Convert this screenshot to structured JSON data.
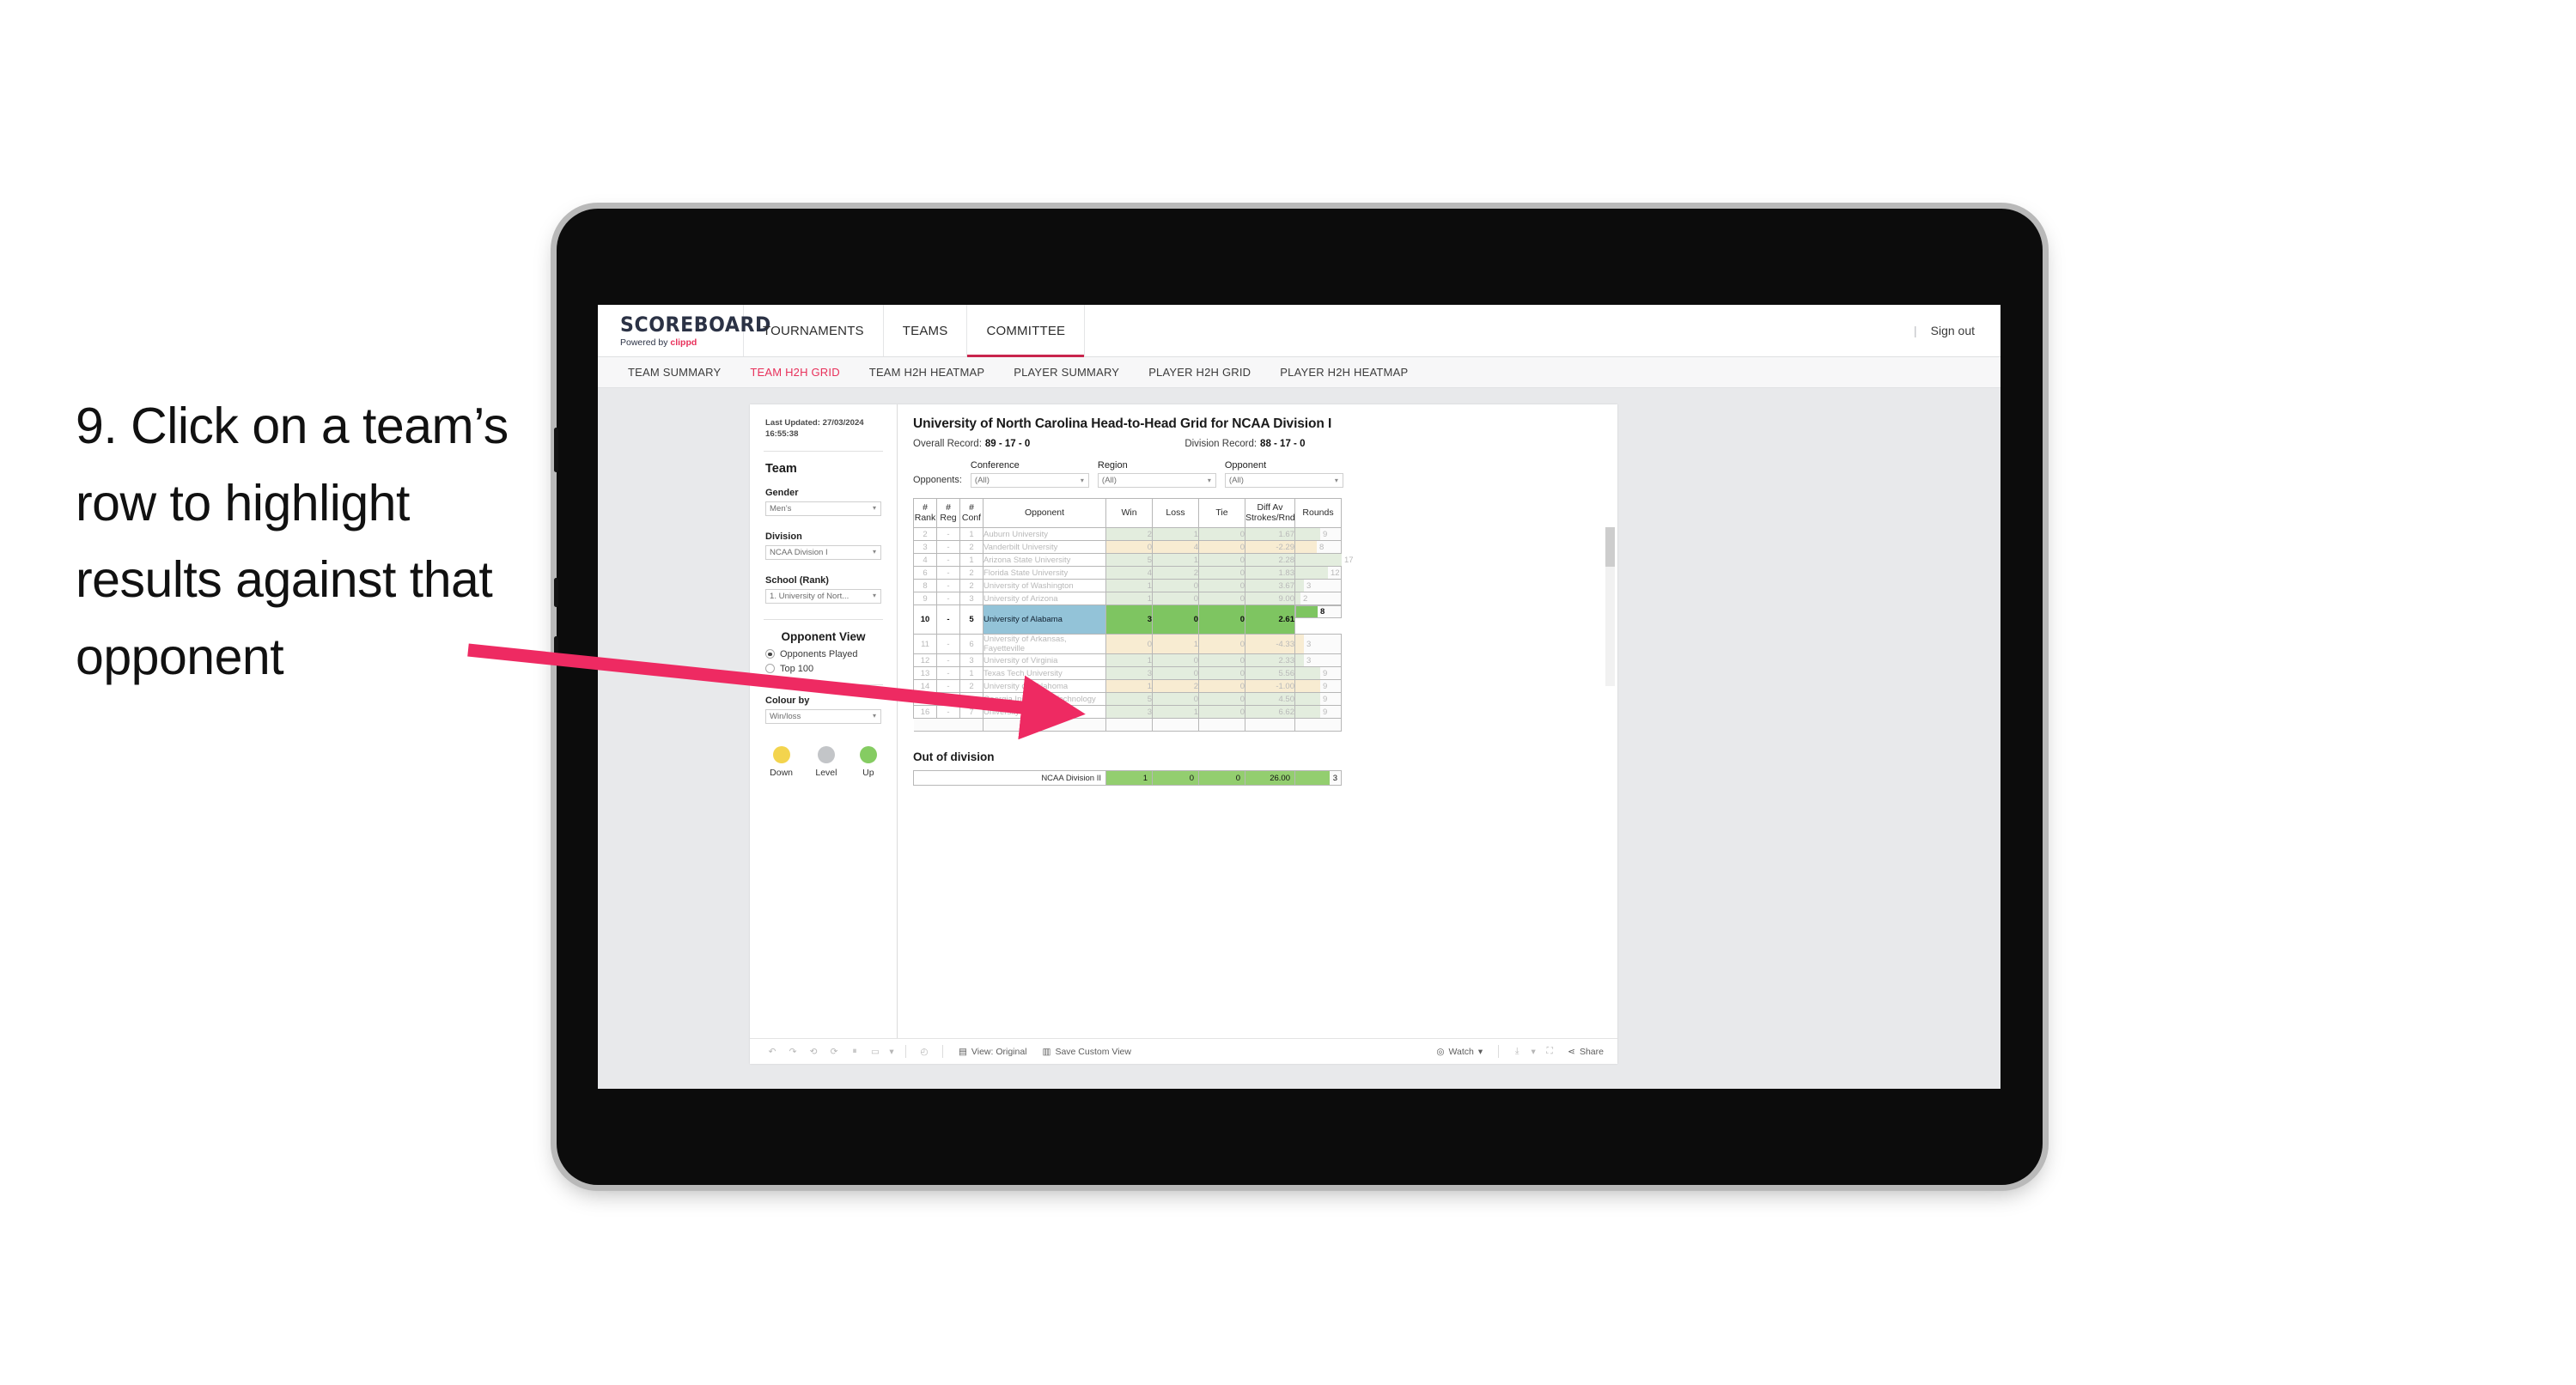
{
  "annotation": {
    "text": "9. Click on a team’s row to highlight results against that opponent",
    "arrow_color": "#ee2a62"
  },
  "app": {
    "brand": {
      "name": "SCOREBOARD",
      "powered_prefix": "Powered by ",
      "powered_brand": "clippd"
    },
    "top_nav": [
      {
        "label": "TOURNAMENTS",
        "active": false
      },
      {
        "label": "TEAMS",
        "active": false
      },
      {
        "label": "COMMITTEE",
        "active": true
      }
    ],
    "sign_out": "Sign out",
    "sub_nav": [
      {
        "label": "TEAM SUMMARY",
        "active": false
      },
      {
        "label": "TEAM H2H GRID",
        "active": true
      },
      {
        "label": "TEAM H2H HEATMAP",
        "active": false
      },
      {
        "label": "PLAYER SUMMARY",
        "active": false
      },
      {
        "label": "PLAYER H2H GRID",
        "active": false
      },
      {
        "label": "PLAYER H2H HEATMAP",
        "active": false
      }
    ]
  },
  "sidepanel": {
    "last_updated": "Last Updated: 27/03/2024 16:55:38",
    "team_heading": "Team",
    "gender_label": "Gender",
    "gender_value": "Men’s",
    "division_label": "Division",
    "division_value": "NCAA Division I",
    "school_label": "School (Rank)",
    "school_value": "1. University of Nort...",
    "opponent_view_heading": "Opponent View",
    "opponent_view_options": [
      {
        "label": "Opponents Played",
        "selected": true
      },
      {
        "label": "Top 100",
        "selected": false
      }
    ],
    "colour_by_label": "Colour by",
    "colour_by_value": "Win/loss",
    "legend": [
      {
        "label": "Down",
        "color": "#f3d44e"
      },
      {
        "label": "Level",
        "color": "#c3c5c8"
      },
      {
        "label": "Up",
        "color": "#85cc62"
      }
    ]
  },
  "main": {
    "title": "University of North Carolina Head-to-Head Grid for NCAA Division I",
    "overall_record_label": "Overall Record:",
    "overall_record_value": "89 - 17 - 0",
    "division_record_label": "Division Record:",
    "division_record_value": "88 - 17 - 0",
    "opponents_label": "Opponents:",
    "filters": [
      {
        "label": "Conference",
        "value": "(All)"
      },
      {
        "label": "Region",
        "value": "(All)"
      },
      {
        "label": "Opponent",
        "value": "(All)"
      }
    ],
    "out_of_division_title": "Out of division"
  },
  "chart_data": {
    "type": "table",
    "title": "University of North Carolina Head-to-Head Grid for NCAA Division I",
    "columns": [
      "# Rank",
      "# Reg",
      "# Conf",
      "Opponent",
      "Win",
      "Loss",
      "Tie",
      "Diff Av Strokes/Rnd",
      "Rounds"
    ],
    "column_headers_multiline": [
      [
        "#",
        "Rank"
      ],
      [
        "#",
        "Reg"
      ],
      [
        "#",
        "Conf"
      ],
      [
        "Opponent"
      ],
      [
        "Win"
      ],
      [
        "Loss"
      ],
      [
        "Tie"
      ],
      [
        "Diff Av",
        "Strokes/Rnd"
      ],
      [
        "Rounds"
      ]
    ],
    "rows": [
      {
        "rank": "2",
        "reg": "-",
        "conf": "1",
        "opponent": "Auburn University",
        "win": "2",
        "loss": "1",
        "tie": "0",
        "diff": "1.67",
        "rounds": "9",
        "result": "win",
        "selected": false
      },
      {
        "rank": "3",
        "reg": "-",
        "conf": "2",
        "opponent": "Vanderbilt University",
        "win": "0",
        "loss": "4",
        "tie": "0",
        "diff": "-2.29",
        "rounds": "8",
        "result": "loss",
        "selected": false
      },
      {
        "rank": "4",
        "reg": "-",
        "conf": "1",
        "opponent": "Arizona State University",
        "win": "5",
        "loss": "1",
        "tie": "0",
        "diff": "2.28",
        "rounds": "17",
        "result": "win",
        "selected": false
      },
      {
        "rank": "6",
        "reg": "-",
        "conf": "2",
        "opponent": "Florida State University",
        "win": "4",
        "loss": "2",
        "tie": "0",
        "diff": "1.83",
        "rounds": "12",
        "result": "win",
        "selected": false
      },
      {
        "rank": "8",
        "reg": "-",
        "conf": "2",
        "opponent": "University of Washington",
        "win": "1",
        "loss": "0",
        "tie": "0",
        "diff": "3.67",
        "rounds": "3",
        "result": "win",
        "selected": false
      },
      {
        "rank": "9",
        "reg": "-",
        "conf": "3",
        "opponent": "University of Arizona",
        "win": "1",
        "loss": "0",
        "tie": "0",
        "diff": "9.00",
        "rounds": "2",
        "result": "win",
        "selected": false
      },
      {
        "rank": "10",
        "reg": "-",
        "conf": "5",
        "opponent": "University of Alabama",
        "win": "3",
        "loss": "0",
        "tie": "0",
        "diff": "2.61",
        "rounds": "8",
        "result": "win",
        "selected": true
      },
      {
        "rank": "11",
        "reg": "-",
        "conf": "6",
        "opponent": "University of Arkansas, Fayetteville",
        "win": "0",
        "loss": "1",
        "tie": "0",
        "diff": "-4.33",
        "rounds": "3",
        "result": "loss",
        "selected": false
      },
      {
        "rank": "12",
        "reg": "-",
        "conf": "3",
        "opponent": "University of Virginia",
        "win": "1",
        "loss": "0",
        "tie": "0",
        "diff": "2.33",
        "rounds": "3",
        "result": "win",
        "selected": false
      },
      {
        "rank": "13",
        "reg": "-",
        "conf": "1",
        "opponent": "Texas Tech University",
        "win": "3",
        "loss": "0",
        "tie": "0",
        "diff": "5.56",
        "rounds": "9",
        "result": "win",
        "selected": false
      },
      {
        "rank": "14",
        "reg": "-",
        "conf": "2",
        "opponent": "University of Oklahoma",
        "win": "1",
        "loss": "2",
        "tie": "0",
        "diff": "-1.00",
        "rounds": "9",
        "result": "loss",
        "selected": false
      },
      {
        "rank": "15",
        "reg": "-",
        "conf": "4",
        "opponent": "Georgia Institute of Technology",
        "win": "5",
        "loss": "0",
        "tie": "0",
        "diff": "4.50",
        "rounds": "9",
        "result": "win",
        "selected": false
      },
      {
        "rank": "16",
        "reg": "-",
        "conf": "7",
        "opponent": "University of Florida",
        "win": "3",
        "loss": "1",
        "tie": "0",
        "diff": "6.62",
        "rounds": "9",
        "result": "win",
        "selected": false
      }
    ],
    "out_of_division": [
      {
        "label": "NCAA Division II",
        "win": "1",
        "loss": "0",
        "tie": "0",
        "diff": "26.00",
        "rounds": "3"
      }
    ],
    "rounds_max": 17
  },
  "toolbar": {
    "view_label": "View: Original",
    "save_label": "Save Custom View",
    "watch_label": "Watch",
    "share_label": "Share"
  }
}
